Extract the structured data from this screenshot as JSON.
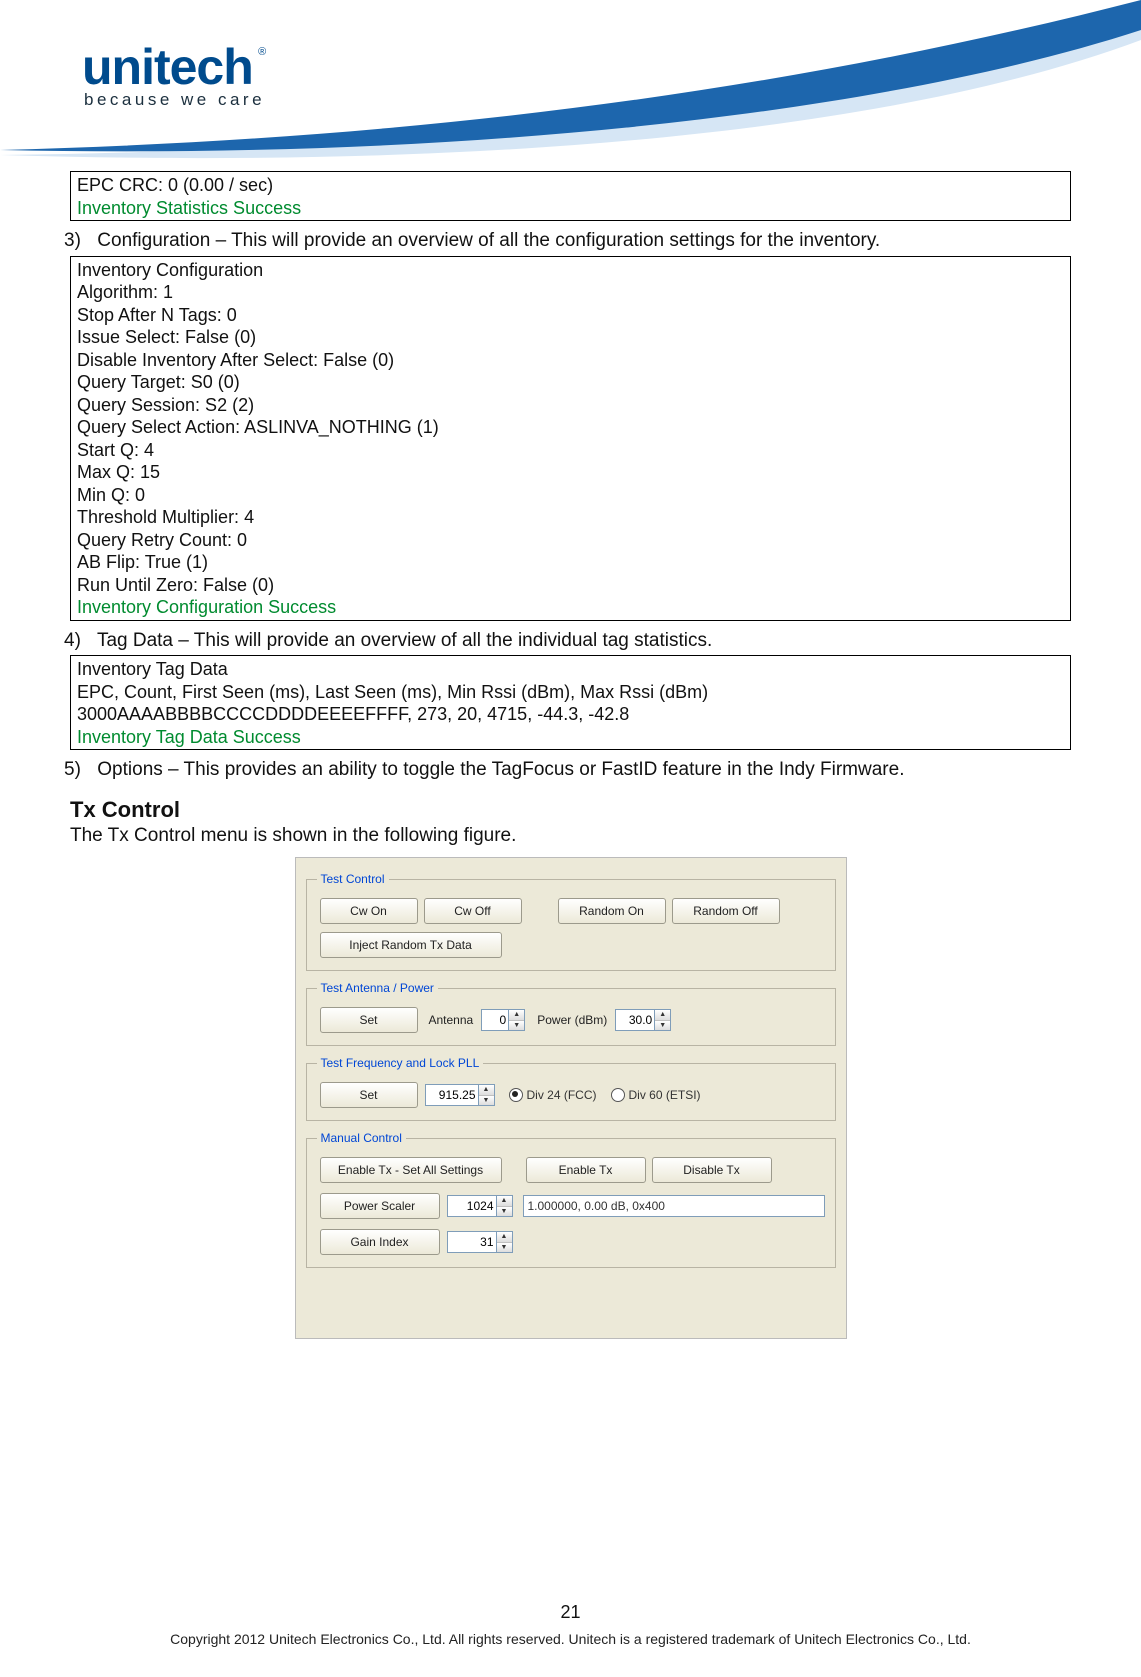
{
  "logo": {
    "brand": "unitech",
    "tagline": "because we care"
  },
  "box1": {
    "line": "EPC CRC: 0 (0.00 / sec)",
    "status": "Inventory Statistics Success"
  },
  "item3": {
    "num": "3)",
    "text": "Configuration – This will provide an overview of all the configuration settings for the inventory."
  },
  "box2": {
    "title": "Inventory Configuration",
    "rows": [
      "Algorithm: 1",
      "Stop After N Tags: 0",
      "Issue Select: False (0)",
      "Disable Inventory After Select: False (0)",
      "Query Target: S0 (0)",
      "Query Session: S2 (2)",
      "Query Select Action: ASLINVA_NOTHING (1)",
      "Start Q: 4",
      "Max Q: 15",
      "Min Q: 0",
      "Threshold Multiplier: 4",
      "Query Retry Count: 0",
      "AB Flip: True (1)",
      "Run Until Zero: False (0)"
    ],
    "status": "Inventory Configuration Success"
  },
  "item4": {
    "num": "4)",
    "text": "Tag Data – This will provide an overview of all the individual tag statistics."
  },
  "box3": {
    "title": "Inventory Tag Data",
    "header": "EPC, Count, First Seen (ms), Last Seen (ms), Min Rssi (dBm), Max Rssi (dBm)",
    "row": "3000AAAABBBBCCCCDDDDEEEEFFFF, 273, 20, 4715, -44.3, -42.8",
    "status": "Inventory Tag Data Success"
  },
  "item5": {
    "num": "5)",
    "text": "Options – This provides an ability to toggle the TagFocus or FastID feature in the Indy Firmware."
  },
  "tx": {
    "heading": "Tx  Control",
    "intro": "The Tx Control menu is shown in the following figure."
  },
  "ui": {
    "test_control": {
      "legend": "Test Control",
      "cw_on": "Cw On",
      "cw_off": "Cw Off",
      "random_on": "Random On",
      "random_off": "Random Off",
      "inject": "Inject Random Tx Data"
    },
    "antenna_power": {
      "legend": "Test Antenna / Power",
      "set": "Set",
      "antenna_label": "Antenna",
      "antenna_value": "0",
      "power_label": "Power (dBm)",
      "power_value": "30.0"
    },
    "freq": {
      "legend": "Test Frequency and Lock PLL",
      "set": "Set",
      "value": "915.25",
      "div24": "Div 24 (FCC)",
      "div60": "Div 60 (ETSI)"
    },
    "manual": {
      "legend": "Manual Control",
      "enable_all": "Enable Tx - Set All Settings",
      "enable": "Enable Tx",
      "disable": "Disable Tx",
      "power_scaler": "Power Scaler",
      "power_scaler_val": "1024",
      "readout": "1.000000, 0.00 dB, 0x400",
      "gain_index": "Gain Index",
      "gain_index_val": "31"
    }
  },
  "page_number": "21",
  "copyright": "Copyright 2012 Unitech Electronics Co., Ltd. All rights reserved. Unitech is a registered trademark of Unitech Electronics Co., Ltd."
}
